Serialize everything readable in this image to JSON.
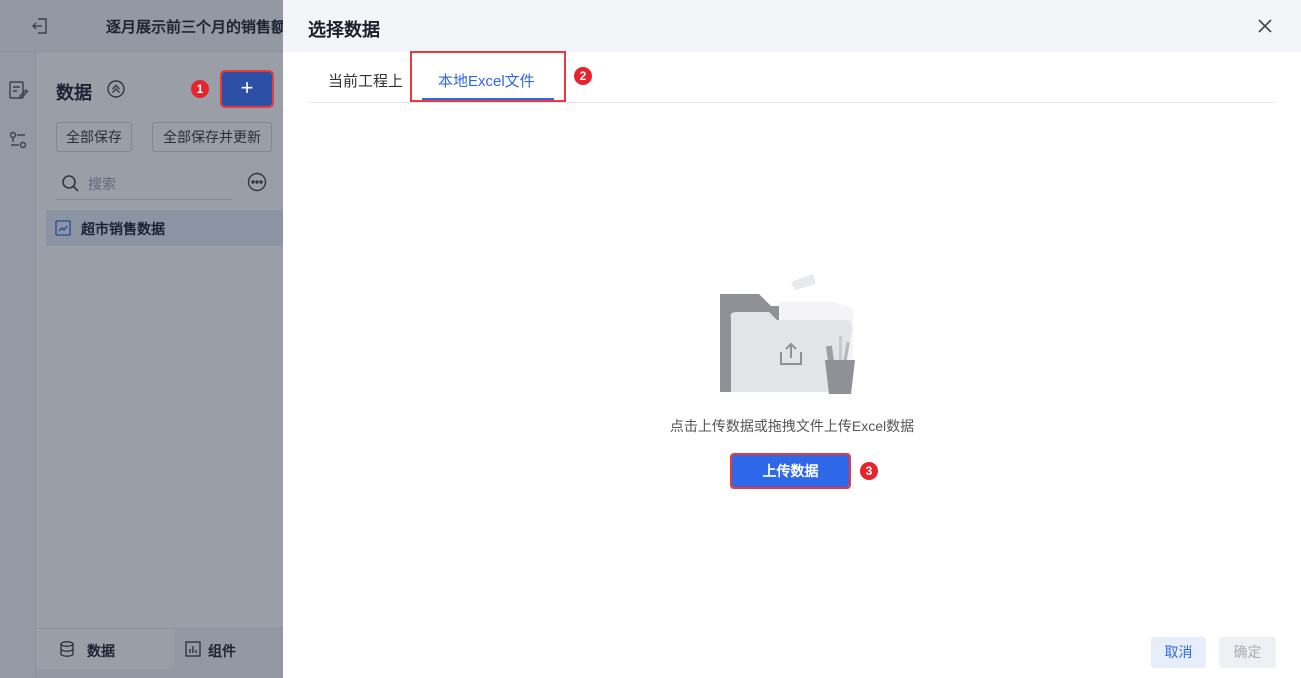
{
  "app": {
    "report_title": "逐月展示前三个月的销售额",
    "panel_title": "数据",
    "add_label": "+",
    "save_all": "全部保存",
    "save_all_update": "全部保存并更新",
    "search_placeholder": "搜索",
    "dataset_item": "超市销售数据",
    "bottom_tabs": [
      {
        "label": "数据",
        "icon": "database-icon",
        "active": true
      },
      {
        "label": "组件",
        "icon": "bar-chart-icon",
        "active": false
      }
    ]
  },
  "badges": [
    "1",
    "2",
    "3"
  ],
  "dialog": {
    "title": "选择数据",
    "tabs": [
      {
        "label": "当前工程上",
        "active": false
      },
      {
        "label": "本地Excel文件",
        "active": true
      }
    ],
    "hint": "点击上传数据或拖拽文件上传Excel数据",
    "upload_label": "上传数据",
    "cancel_label": "取消",
    "ok_label": "确定"
  },
  "colors": {
    "accent": "#2e68e8",
    "highlight": "#e83a3a",
    "badge": "#e8232e"
  }
}
